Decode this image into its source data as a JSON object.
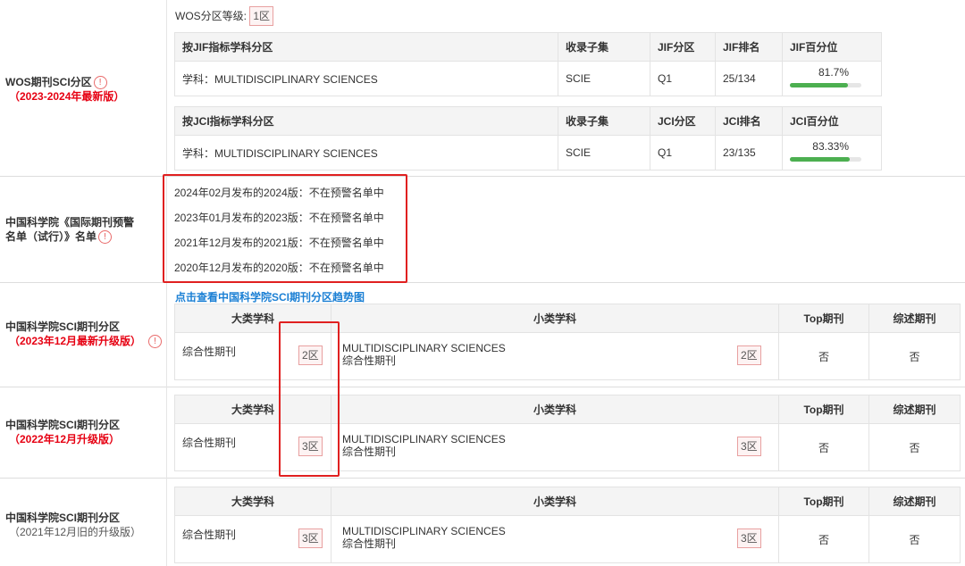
{
  "wos": {
    "grade_label": "WOS分区等级:",
    "grade_value": "1区",
    "left_title": "WOS期刊SCI分区",
    "left_sub": "（2023-2024年最新版）",
    "jif_table": {
      "headers": [
        "按JIF指标学科分区",
        "收录子集",
        "JIF分区",
        "JIF排名",
        "JIF百分位"
      ],
      "row": {
        "subject": "学科：MULTIDISCIPLINARY SCIENCES",
        "subset": "SCIE",
        "quartile": "Q1",
        "rank": "25/134",
        "percentile_text": "81.7%",
        "percentile": 81.7
      }
    },
    "jci_table": {
      "headers": [
        "按JCI指标学科分区",
        "收录子集",
        "JCI分区",
        "JCI排名",
        "JCI百分位"
      ],
      "row": {
        "subject": "学科：MULTIDISCIPLINARY SCIENCES",
        "subset": "SCIE",
        "quartile": "Q1",
        "rank": "23/135",
        "percentile_text": "83.33%",
        "percentile": 83.33
      }
    }
  },
  "warning": {
    "left_title_1": "中国科学院《国际期刊预警",
    "left_title_2": "名单（试行）》名单",
    "lines": [
      "2024年02月发布的2024版：不在预警名单中",
      "2023年01月发布的2023版：不在预警名单中",
      "2021年12月发布的2021版：不在预警名单中",
      "2020年12月发布的2020版：不在预警名单中"
    ]
  },
  "cas_link": "点击查看中国科学院SCI期刊分区趋势图",
  "cas_sections": [
    {
      "title": "中国科学院SCI期刊分区",
      "sub": "（2023年12月最新升级版）",
      "sub_style": "red",
      "has_info": true,
      "headers": [
        "大类学科",
        "小类学科",
        "Top期刊",
        "综述期刊"
      ],
      "major": "综合性期刊",
      "major_zone": "2区",
      "minor_en": "MULTIDISCIPLINARY SCIENCES",
      "minor_cn": "综合性期刊",
      "minor_zone": "2区",
      "top": "否",
      "review": "否"
    },
    {
      "title": "中国科学院SCI期刊分区",
      "sub": "（2022年12月升级版）",
      "sub_style": "red",
      "has_info": false,
      "headers": [
        "大类学科",
        "小类学科",
        "Top期刊",
        "综述期刊"
      ],
      "major": "综合性期刊",
      "major_zone": "3区",
      "minor_en": "MULTIDISCIPLINARY SCIENCES",
      "minor_cn": "综合性期刊",
      "minor_zone": "3区",
      "top": "否",
      "review": "否"
    },
    {
      "title": "中国科学院SCI期刊分区",
      "sub": "（2021年12月旧的升级版）",
      "sub_style": "gray",
      "has_info": false,
      "headers": [
        "大类学科",
        "小类学科",
        "Top期刊",
        "综述期刊"
      ],
      "major": "综合性期刊",
      "major_zone": "3区",
      "minor_en": "MULTIDISCIPLINARY SCIENCES",
      "minor_cn": "综合性期刊",
      "minor_zone": "3区",
      "top": "否",
      "review": "否"
    }
  ],
  "colors": {
    "accent_red": "#e60012",
    "link_blue": "#1a7fd4",
    "bar_green": "#4caf50"
  }
}
